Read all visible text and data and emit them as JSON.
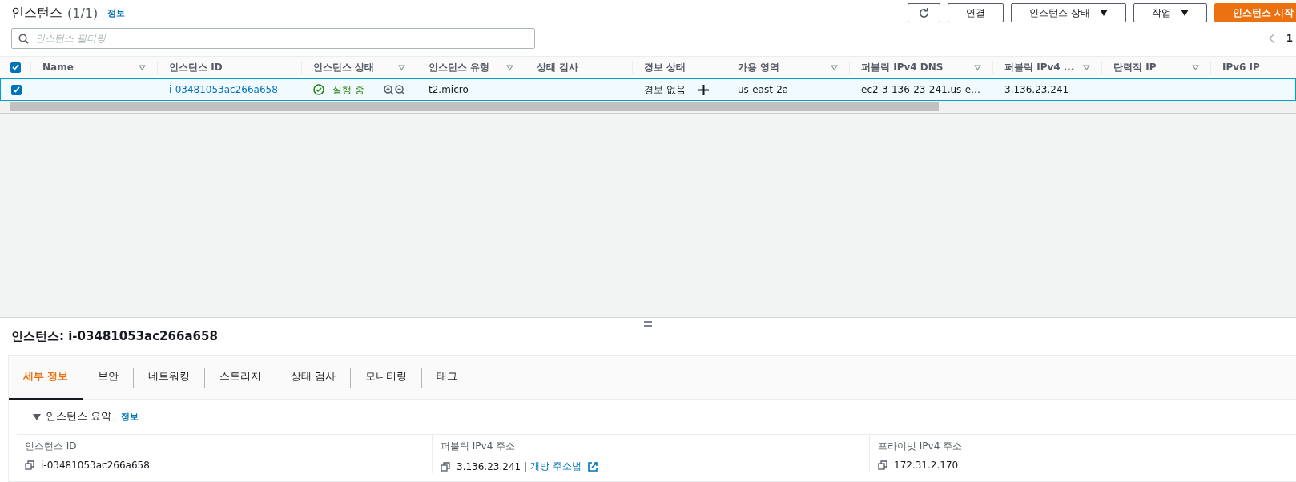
{
  "header": {
    "title": "인스턴스",
    "count": "(1/1)",
    "info_link": "정보",
    "buttons": [
      {
        "kind": "icon"
      },
      {
        "kind": "text",
        "label": "연결"
      },
      {
        "kind": "dropdown",
        "label": "인스턴스 상태"
      },
      {
        "kind": "dropdown",
        "label": "작업"
      },
      {
        "kind": "primary",
        "label": "인스턴스 시작"
      }
    ]
  },
  "search": {
    "placeholder": "인스턴스 필터링"
  },
  "pagination": {
    "page": "1"
  },
  "table": {
    "select_all_checked": true,
    "columns": [
      {
        "label": "Name",
        "filter": true
      },
      {
        "label": "인스턴스 ID",
        "filter": false
      },
      {
        "label": "인스턴스 상태",
        "filter": true
      },
      {
        "label": "인스턴스 유형",
        "filter": true
      },
      {
        "label": "상태 검사",
        "filter": false
      },
      {
        "label": "경보 상태",
        "filter": false
      },
      {
        "label": "가용 영역",
        "filter": true
      },
      {
        "label": "퍼블릭 IPv4 DNS",
        "filter": true
      },
      {
        "label": "퍼블릭 IPv4 ...",
        "filter": true
      },
      {
        "label": "탄력적 IP",
        "filter": true
      },
      {
        "label": "IPv6 IP",
        "filter": false
      }
    ],
    "rows": [
      {
        "checked": true,
        "selected": true,
        "cells": [
          {
            "kind": "text",
            "text": "–"
          },
          {
            "kind": "link",
            "text": "i-03481053ac266a658"
          },
          {
            "kind": "status",
            "text": "실행 중"
          },
          {
            "kind": "text",
            "text": "t2.micro"
          },
          {
            "kind": "text",
            "text": "–"
          },
          {
            "kind": "alarm",
            "text": "경보 없음"
          },
          {
            "kind": "text",
            "text": "us-east-2a"
          },
          {
            "kind": "text",
            "text": "ec2-3-136-23-241.us-e…"
          },
          {
            "kind": "text",
            "text": "3.136.23.241"
          },
          {
            "kind": "text",
            "text": "–"
          },
          {
            "kind": "text",
            "text": "–"
          }
        ]
      }
    ]
  },
  "detail": {
    "title": "인스턴스: i-03481053ac266a658",
    "tabs": [
      {
        "label": "세부 정보",
        "selected": true
      },
      {
        "label": "보안",
        "selected": false
      },
      {
        "label": "네트워킹",
        "selected": false
      },
      {
        "label": "스토리지",
        "selected": false
      },
      {
        "label": "상태 검사",
        "selected": false
      },
      {
        "label": "모니터링",
        "selected": false
      },
      {
        "label": "태그",
        "selected": false
      }
    ],
    "section": {
      "title": "인스턴스 요약",
      "info_link": "정보",
      "expanded": true
    },
    "fields": [
      {
        "label": "인스턴스 ID",
        "value": "i-03481053ac266a658"
      },
      {
        "label": "퍼블릭 IPv4 주소",
        "value": "3.136.23.241 |",
        "link": "개방 주소법"
      },
      {
        "label": "프라이빗 IPv4 주소",
        "value": "172.31.2.170"
      }
    ]
  }
}
